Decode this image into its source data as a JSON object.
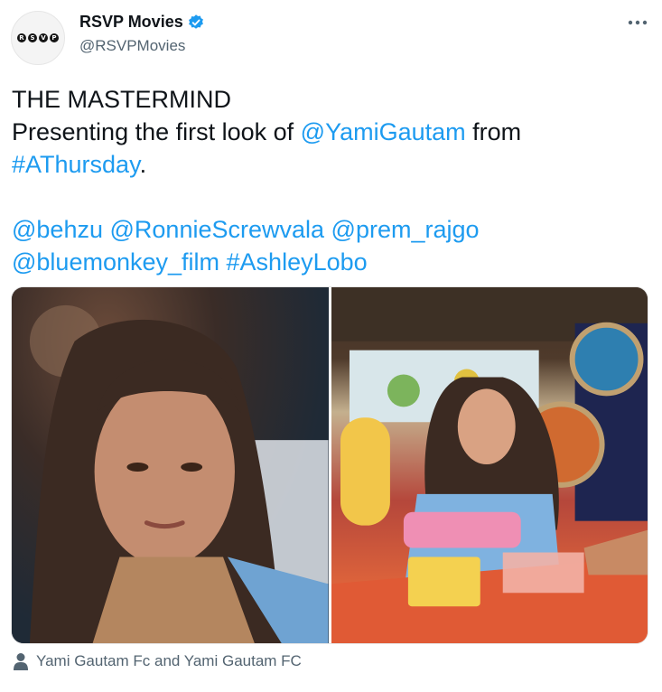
{
  "author": {
    "name": "RSVP Movies",
    "handle": "@RSVPMovies",
    "avatar_letters": [
      "R",
      "S",
      "V",
      "P"
    ],
    "verified": true
  },
  "tweet": {
    "line1": "THE MASTERMIND",
    "line2_prefix": "Presenting the first look of ",
    "line2_mention": "@YamiGautam",
    "line2_suffix": " from",
    "line3_hashtag": "#AThursday",
    "line3_suffix": ".",
    "mentions_row1": [
      "@behzu",
      "@RonnieScrewvala",
      "@prem_rajgo"
    ],
    "mentions_row2": [
      "@bluemonkey_film",
      "#AshleyLobo"
    ]
  },
  "media": {
    "photo_count": 2
  },
  "caption": "Yami Gautam Fc and Yami Gautam FC",
  "colors": {
    "link": "#1d9bf0",
    "text": "#0f1419",
    "secondary": "#536471",
    "verified": "#1d9bf0"
  },
  "icons": {
    "more": "more-horizontal-icon",
    "verified": "verified-badge-icon",
    "tag": "user-tag-icon"
  }
}
